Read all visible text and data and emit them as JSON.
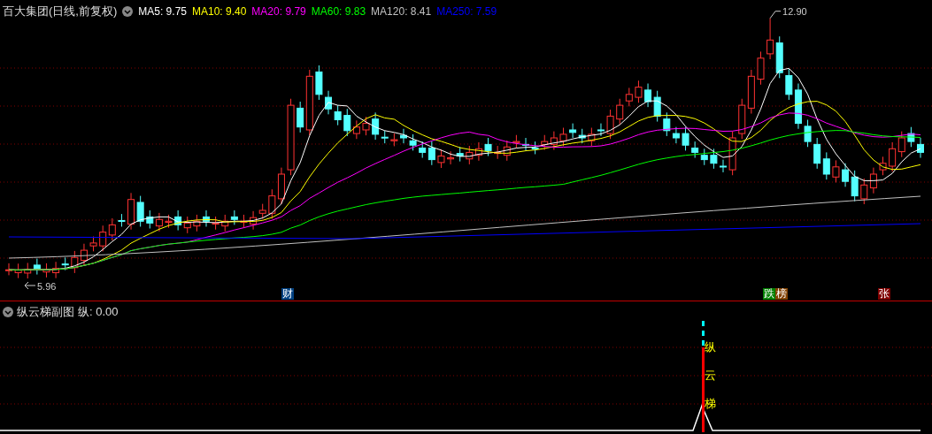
{
  "main_panel": {
    "title": "百大集团(日线,前复权)",
    "ma_labels": [
      {
        "text": "MA5: 9.75",
        "color": "#ffffff"
      },
      {
        "text": "MA10: 9.40",
        "color": "#ffff00"
      },
      {
        "text": "MA20: 9.79",
        "color": "#ff00ff"
      },
      {
        "text": "MA60: 9.83",
        "color": "#00ff00"
      },
      {
        "text": "MA120: 8.41",
        "color": "#c0c0c0"
      },
      {
        "text": "MA250: 7.59",
        "color": "#0000ff"
      }
    ],
    "high_label": "12.90",
    "low_label": "5.96",
    "markers": [
      {
        "text": "财",
        "color": "#004080"
      },
      {
        "text": "跌",
        "color": "#008000"
      },
      {
        "text": "榜",
        "color": "#804000"
      },
      {
        "text": "张",
        "color": "#800000"
      }
    ]
  },
  "sub_panel": {
    "title": "纵云梯副图",
    "value": "纵: 0.00",
    "signal_text": "纵云梯"
  }
}
